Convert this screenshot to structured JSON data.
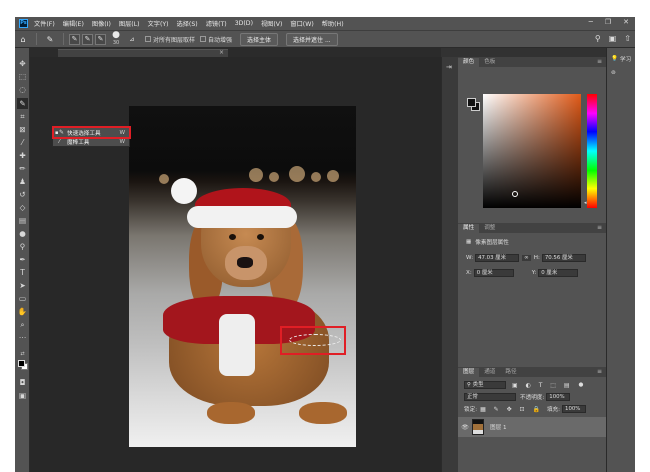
{
  "menu": {
    "logo": "Ps",
    "items": [
      "文件(F)",
      "编辑(E)",
      "图像(I)",
      "图层(L)",
      "文字(Y)",
      "选择(S)",
      "滤镜(T)",
      "3D(D)",
      "视图(V)",
      "窗口(W)",
      "帮助(H)"
    ],
    "win_min": "─",
    "win_max": "❐",
    "win_close": "✕"
  },
  "options": {
    "brush_size": "30",
    "sample_all_layers": "对所有图层取样",
    "auto_enhance": "自动增强",
    "select_subject": "选择主体",
    "select_and_mask": "选择并遮住 ..."
  },
  "flyout": {
    "quick_select": "快速选择工具",
    "quick_select_key": "W",
    "magic_wand": "魔棒工具",
    "magic_wand_key": "W"
  },
  "color_panel": {
    "tab1": "颜色",
    "tab2": "色板"
  },
  "properties_panel": {
    "tab1": "属性",
    "tab2": "调整",
    "layer_props": "像素图层属性",
    "w_label": "W:",
    "w_value": "47.03 厘米",
    "h_label": "H:",
    "h_value": "70.56 厘米",
    "x_label": "X:",
    "x_value": "0 厘米",
    "y_label": "Y:",
    "y_value": "0 厘米"
  },
  "layers_panel": {
    "tab1": "图层",
    "tab2": "通道",
    "tab3": "路径",
    "filter_kind": "类型",
    "blend_mode": "正常",
    "opacity_label": "不透明度:",
    "opacity_value": "100%",
    "lock_label": "锁定:",
    "fill_label": "填充:",
    "fill_value": "100%",
    "layer_name": "图层 1"
  },
  "right_strip": {
    "learn": "学习"
  },
  "colors": {
    "accent_red": "#e01e25",
    "panel": "#535353",
    "canvas": "#282828"
  }
}
